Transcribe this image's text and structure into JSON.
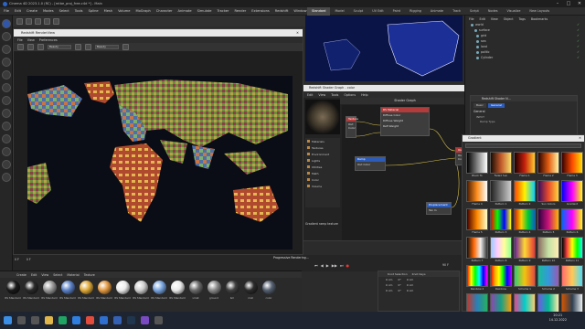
{
  "app": {
    "title": "Cinema 4D 2023.1.0 (RC) - [mtbe_proj_free.c4d *] - Main",
    "window_controls": [
      "–",
      "□",
      "✕"
    ]
  },
  "menu": [
    "File",
    "Edit",
    "Create",
    "Modes",
    "Select",
    "Tools",
    "Spline",
    "Mesh",
    "Volume",
    "MoGraph",
    "Character",
    "Animate",
    "Simulate",
    "Tracker",
    "Render",
    "Extensions",
    "Redshift",
    "Window",
    "Help"
  ],
  "layouts": [
    "Standard",
    "Model",
    "Sculpt",
    "UV Edit",
    "Paint",
    "Rigging",
    "Animate",
    "Track",
    "Script",
    "Nodes",
    "Visualize"
  ],
  "layouts_active": "Standard",
  "new_layouts": "New Layouts",
  "render_view": {
    "title": "Redshift RenderView",
    "menu": [
      "File",
      "View",
      "Preferences"
    ],
    "dropdowns": [
      "Beauty",
      "Beauty"
    ]
  },
  "shader_graph": {
    "title": "Redshift Shader Graph - color",
    "header": "Shader Graph",
    "menu": [
      "Edit",
      "View",
      "Tools",
      "Options",
      "Help"
    ],
    "tree": [
      "Materials",
      "Textures",
      "Environment",
      "Lights",
      "Utilities",
      "Math",
      "Color",
      "Volume"
    ],
    "nodes": [
      {
        "title": "RS Material",
        "ports": [
          "Diffuse Color",
          "Diffuse Weight",
          "Refl Weight"
        ]
      },
      {
        "title": "Output",
        "ports": [
          "Out Color"
        ]
      },
      {
        "title": "Texture",
        "ports": [
          "Out Color"
        ]
      },
      {
        "title": "Ramp",
        "ports": [
          "Out Color"
        ]
      },
      {
        "title": "Displacement",
        "ports": [
          "Tex In"
        ]
      }
    ],
    "footer": "Gradient ramp texture"
  },
  "object_manager": {
    "tabs": [
      "File",
      "Edit",
      "View",
      "Object",
      "Tags",
      "Bookmarks"
    ],
    "objects": [
      "world",
      "surface",
      "grid",
      "sea",
      "land",
      "politic",
      "Cylinder"
    ]
  },
  "attributes": {
    "title": "Redshift Shader N...",
    "tabs": [
      "Basic",
      "General"
    ],
    "active_tab": "General",
    "section": "INPUT",
    "params": [
      "Ramp Type"
    ]
  },
  "gradient_picker": {
    "title": "Gradient",
    "swatches": [
      {
        "name": "Black To",
        "colors": [
          "#000",
          "#fff"
        ]
      },
      {
        "name": "Faded Sun",
        "colors": [
          "#1a0d05",
          "#c0582a",
          "#f7d96c"
        ]
      },
      {
        "name": "Flame 1",
        "colors": [
          "#200000",
          "#c31f0c",
          "#ffcb2c"
        ]
      },
      {
        "name": "Flame 2",
        "colors": [
          "#2b0500",
          "#e25b10",
          "#fff2a0"
        ]
      },
      {
        "name": "Flame 3",
        "colors": [
          "#3a0000",
          "#ff4a00",
          "#ffe000"
        ]
      },
      {
        "name": "Flame 4",
        "colors": [
          "#4b1a00",
          "#ff8f1f",
          "#fff"
        ]
      },
      {
        "name": "Pattern 1",
        "colors": [
          "#222",
          "#777",
          "#ccc"
        ]
      },
      {
        "name": "Pattern 2",
        "colors": [
          "#ff4400",
          "#fff200",
          "#00d0ff"
        ]
      },
      {
        "name": "Sun Colors",
        "colors": [
          "#3a0b5e",
          "#e84b2c",
          "#ffd23a"
        ]
      },
      {
        "name": "Gradient",
        "colors": [
          "#0000ff",
          "#ff00ff",
          "#ffff00"
        ]
      },
      {
        "name": "Flame 5",
        "colors": [
          "#400",
          "#f80",
          "#ffc"
        ]
      },
      {
        "name": "Pattern 3",
        "colors": [
          "#ff0000",
          "#00ff00",
          "#0000ff",
          "#ffff00"
        ]
      },
      {
        "name": "Pattern 4",
        "colors": [
          "#c20",
          "#fc0",
          "#0c3",
          "#06c"
        ]
      },
      {
        "name": "Pattern 5",
        "colors": [
          "#2d003f",
          "#c8137b",
          "#ffb400"
        ]
      },
      {
        "name": "Pattern 6",
        "colors": [
          "#06f",
          "#f0f",
          "#ff0"
        ]
      },
      {
        "name": "Pattern 7",
        "colors": [
          "#111",
          "#f60",
          "#eee",
          "#333"
        ]
      },
      {
        "name": "Pattern 8",
        "colors": [
          "#9cf",
          "#fcf",
          "#ff9",
          "#9f9"
        ]
      },
      {
        "name": "Pattern 9",
        "colors": [
          "#6a1b9a",
          "#fdd835",
          "#e53935"
        ]
      },
      {
        "name": "Pattern 10",
        "colors": [
          "#8d6e63",
          "#c5e1a5",
          "#ffecb3"
        ]
      },
      {
        "name": "Pattern 11",
        "colors": [
          "#000",
          "#f44",
          "#ff0",
          "#0f0",
          "#0ff"
        ]
      },
      {
        "name": "Rainbow 2",
        "colors": [
          "#f00",
          "#ff0",
          "#0f0",
          "#0ff",
          "#00f",
          "#f0f"
        ]
      },
      {
        "name": "Rainbow",
        "colors": [
          "#f00",
          "#fa0",
          "#ff0",
          "#0f0",
          "#00f",
          "#90f"
        ]
      },
      {
        "name": "Scheme 1",
        "colors": [
          "#2ecc71",
          "#f1c40f",
          "#e74c3c"
        ]
      },
      {
        "name": "Scheme 2",
        "colors": [
          "#1abc9c",
          "#3498db",
          "#9b59b6"
        ]
      },
      {
        "name": "Scheme 3",
        "colors": [
          "#ff6b6b",
          "#feca57",
          "#48dbfb"
        ]
      },
      {
        "name": "Scheme 4",
        "colors": [
          "#c0392b",
          "#2980b9",
          "#27ae60"
        ]
      },
      {
        "name": "Scheme 5",
        "colors": [
          "#8e44ad",
          "#16a085",
          "#f39c12"
        ]
      },
      {
        "name": "Scheme 6",
        "colors": [
          "#e84393",
          "#00cec9",
          "#fdcb6e"
        ]
      },
      {
        "name": "Scheme 7",
        "colors": [
          "#6c5ce7",
          "#00b894",
          "#ffeaa7"
        ]
      },
      {
        "name": "No 1",
        "colors": [
          "#d35400",
          "#2c3e50",
          "#ecf0f1"
        ]
      }
    ]
  },
  "timeline": {
    "frame_start": "0 F",
    "frame_end": "90 F",
    "current": "0 F",
    "label": "Progressive Rendering..."
  },
  "material_manager": {
    "menu": [
      "Create",
      "Edit",
      "View",
      "Select",
      "Material",
      "Texture"
    ],
    "materials": [
      {
        "name": "RS Standard",
        "color": "#1a1a1a"
      },
      {
        "name": "RS Standard",
        "color": "#2a2a2a"
      },
      {
        "name": "RS Standard",
        "color": "#9a9a9a"
      },
      {
        "name": "RS Standard",
        "color": "#5c82c7"
      },
      {
        "name": "RS Standard",
        "color": "#e0aa3a"
      },
      {
        "name": "RS Standard",
        "color": "#e39a43"
      },
      {
        "name": "RS Standard",
        "color": "#ececec"
      },
      {
        "name": "RS Standard",
        "color": "#cfcfcf"
      },
      {
        "name": "RS Standard",
        "color": "#7aa6e0"
      },
      {
        "name": "RS Standard",
        "color": "#eaeaea"
      },
      {
        "name": "vmat",
        "color": "#6b6b6b"
      },
      {
        "name": "ground",
        "color": "#8a8a8a"
      },
      {
        "name": "bm",
        "color": "#404040"
      },
      {
        "name": "mat",
        "color": "#2c2c2c"
      },
      {
        "name": "color",
        "color": "#556070"
      }
    ]
  },
  "ramp": {
    "headers": [
      "Knot Selection",
      "Knot Keys"
    ],
    "rows": [
      [
        "0 cm",
        "0°",
        "0 cm"
      ],
      [
        "0 cm",
        "0°",
        "0 cm"
      ],
      [
        "0 cm",
        "0°",
        "0 cm"
      ]
    ]
  },
  "clock": {
    "time": "20:21",
    "date": "14.12.2022"
  }
}
